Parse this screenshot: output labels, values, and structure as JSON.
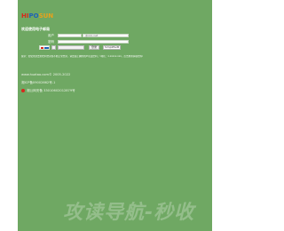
{
  "logo": {
    "part1": "HI",
    "part2": "PO",
    "part3": "SUN"
  },
  "welcome": "欢迎使用电子邮局",
  "form": {
    "user_label": "用户",
    "user_value": "",
    "user_suffix": "@xxx.net",
    "password_label": "密码",
    "password_value": "",
    "login_button": "登录",
    "lang_select": "Simplified"
  },
  "note": "提示：若使用过去的密码登录而不能正常登录，请尝试正确的用户名及密码；（域名：1.xxxxx.xxx，点击重新获取密码）",
  "footer": {
    "domain_line": "www.huatao.com© 2005-2022",
    "icp": "湘ICP备09002662号-1",
    "police": "湘公网安备 33010602012879号"
  },
  "watermark": "攻读导航-秒收",
  "colors": {
    "panel": "#6fa863",
    "background": "#ffffff"
  }
}
